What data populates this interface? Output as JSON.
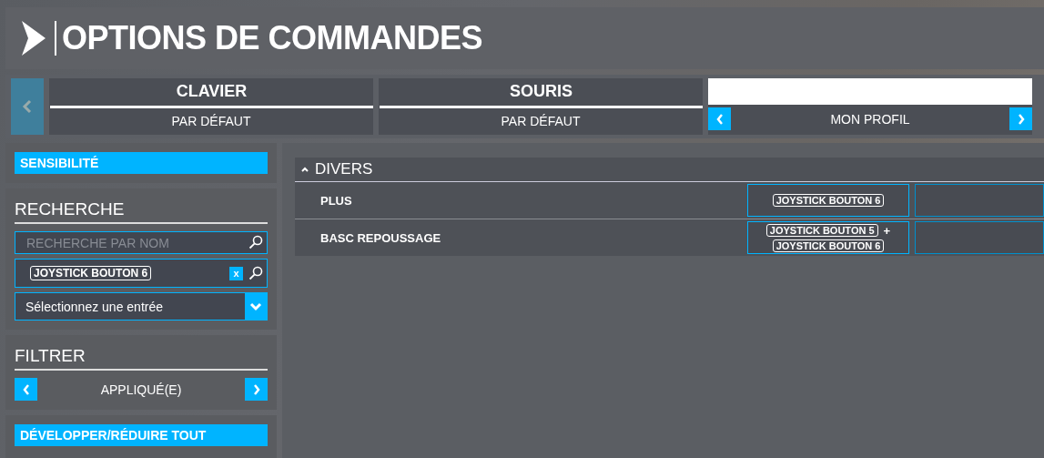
{
  "header": {
    "title": "OPTIONS DE COMMANDES"
  },
  "device_tabs": {
    "prev_disabled": true,
    "tabs": [
      {
        "label": "CLAVIER",
        "profile": "PAR DÉFAUT",
        "selected": false
      },
      {
        "label": "SOURIS",
        "profile": "PAR DÉFAUT",
        "selected": false
      },
      {
        "profile": "MON PROFIL",
        "selected": true
      }
    ]
  },
  "sidebar": {
    "sensitivity_button": "SENSIBILITÉ",
    "search": {
      "title": "RECHERCHE",
      "placeholder": "RECHERCHE PAR NOM",
      "input_tag": "JOYSTICK BOUTON 6",
      "clear_label": "x",
      "dropdown": "Sélectionnez une entrée"
    },
    "filter": {
      "title": "FILTRER",
      "value": "APPLIQUÉ(E)"
    },
    "expand_button": "DÉVELOPPER/RÉDUIRE TOUT"
  },
  "section": {
    "title": "DIVERS",
    "expanded": true,
    "rows": [
      {
        "name": "PLUS",
        "keys": [
          "JOYSTICK BOUTON 6"
        ],
        "joiner": ""
      },
      {
        "name": "BASC REPOUSSAGE",
        "keys": [
          "JOYSTICK BOUTON 5",
          "JOYSTICK BOUTON 6"
        ],
        "joiner": "+"
      }
    ]
  }
}
